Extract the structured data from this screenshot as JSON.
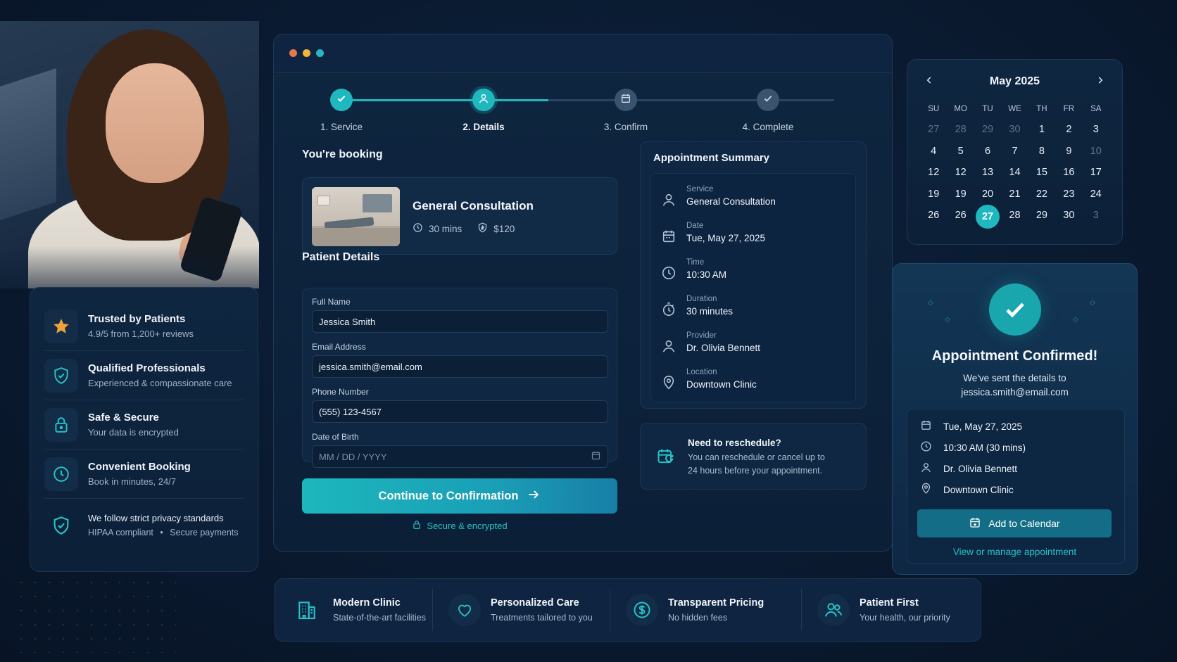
{
  "colors": {
    "accent": "#1fb8be",
    "accent_text": "#27c2c9",
    "panel": "#0f2742",
    "background": "#0a1a30",
    "star": "#f0a23a"
  },
  "window": {
    "dots": [
      "#e8774f",
      "#f2b53a",
      "#27b6c4"
    ]
  },
  "stepper": {
    "progress": 0.42,
    "steps": [
      {
        "label": "1. Service",
        "state": "done",
        "icon": "check-icon"
      },
      {
        "label": "2. Details",
        "state": "active",
        "icon": "user-icon"
      },
      {
        "label": "3. Confirm",
        "state": "upcoming",
        "icon": "calendar-icon"
      },
      {
        "label": "4. Complete",
        "state": "upcoming",
        "icon": "check-icon"
      }
    ]
  },
  "booking": {
    "heading": "You're booking",
    "service": {
      "title": "General Consultation",
      "duration": "30 mins",
      "price": "$120"
    }
  },
  "patient": {
    "heading": "Patient Details",
    "fields": {
      "full_name": {
        "label": "Full Name",
        "value": "Jessica Smith"
      },
      "email": {
        "label": "Email Address",
        "value": "jessica.smith@email.com"
      },
      "phone": {
        "label": "Phone Number",
        "value": "(555) 123-4567"
      },
      "dob": {
        "label": "Date of Birth",
        "placeholder": "MM / DD / YYYY"
      }
    },
    "cta": "Continue to Confirmation",
    "secure_note": "Secure & encrypted"
  },
  "summary": {
    "heading": "Appointment Summary",
    "rows": [
      {
        "key": "Service",
        "value": "General Consultation",
        "icon": "user-icon"
      },
      {
        "key": "Date",
        "value": "Tue, May 27, 2025",
        "icon": "calendar-icon"
      },
      {
        "key": "Time",
        "value": "10:30 AM",
        "icon": "clock-icon"
      },
      {
        "key": "Duration",
        "value": "30 minutes",
        "icon": "timer-icon"
      },
      {
        "key": "Provider",
        "value": "Dr. Olivia Bennett",
        "icon": "user-icon"
      },
      {
        "key": "Location",
        "value": "Downtown Clinic",
        "icon": "pin-icon"
      }
    ]
  },
  "reschedule": {
    "title": "Need to reschedule?",
    "text_line1": "You can reschedule or cancel up to",
    "text_line2": "24 hours before your appointment."
  },
  "trust": {
    "items": [
      {
        "title": "Trusted by Patients",
        "sub": "4.9/5 from 1,200+ reviews",
        "icon": "star-icon"
      },
      {
        "title": "Qualified Professionals",
        "sub": "Experienced & compassionate care",
        "icon": "shield-check-icon"
      },
      {
        "title": "Safe & Secure",
        "sub": "Your data is encrypted",
        "icon": "lock-icon"
      },
      {
        "title": "Convenient Booking",
        "sub": "Book in minutes, 24/7",
        "icon": "clock-icon"
      }
    ],
    "privacy_title": "We follow strict privacy standards",
    "privacy_sub_a": "HIPAA compliant",
    "privacy_sep": "•",
    "privacy_sub_b": "Secure payments"
  },
  "calendar": {
    "title": "May 2025",
    "dow": [
      "SU",
      "MO",
      "TU",
      "WE",
      "TH",
      "FR",
      "SA"
    ],
    "weeks": [
      [
        {
          "d": "27",
          "dim": true
        },
        {
          "d": "28",
          "dim": true
        },
        {
          "d": "29",
          "dim": true
        },
        {
          "d": "30",
          "dim": true
        },
        {
          "d": "1"
        },
        {
          "d": "2"
        },
        {
          "d": "3"
        }
      ],
      [
        {
          "d": "4"
        },
        {
          "d": "5"
        },
        {
          "d": "6"
        },
        {
          "d": "7"
        },
        {
          "d": "8"
        },
        {
          "d": "9"
        },
        {
          "d": "10",
          "dim": true
        }
      ],
      [
        {
          "d": "12"
        },
        {
          "d": "12"
        },
        {
          "d": "13"
        },
        {
          "d": "14"
        },
        {
          "d": "15"
        },
        {
          "d": "16"
        },
        {
          "d": "17"
        }
      ],
      [
        {
          "d": "19"
        },
        {
          "d": "19"
        },
        {
          "d": "20"
        },
        {
          "d": "21"
        },
        {
          "d": "22"
        },
        {
          "d": "23"
        },
        {
          "d": "24"
        }
      ],
      [
        {
          "d": "26"
        },
        {
          "d": "26"
        },
        {
          "d": "27",
          "sel": true
        },
        {
          "d": "28"
        },
        {
          "d": "29"
        },
        {
          "d": "30"
        },
        {
          "d": "3",
          "dim": true
        }
      ]
    ]
  },
  "confirmed": {
    "title": "Appointment Confirmed!",
    "sub1": "We've sent the details to",
    "sub2": "jessica.smith@email.com",
    "date": "Tue, May 27, 2025",
    "time": "10:30 AM (30 mins)",
    "provider": "Dr. Olivia Bennett",
    "location": "Downtown Clinic",
    "add_calendar": "Add to Calendar",
    "manage": "View or manage appointment"
  },
  "features": [
    {
      "title": "Modern Clinic",
      "sub": "State-of-the-art facilities",
      "icon": "building-icon"
    },
    {
      "title": "Personalized Care",
      "sub": "Treatments tailored to you",
      "icon": "heart-icon"
    },
    {
      "title": "Transparent Pricing",
      "sub": "No hidden fees",
      "icon": "dollar-icon"
    },
    {
      "title": "Patient First",
      "sub": "Your health, our priority",
      "icon": "users-icon"
    }
  ]
}
